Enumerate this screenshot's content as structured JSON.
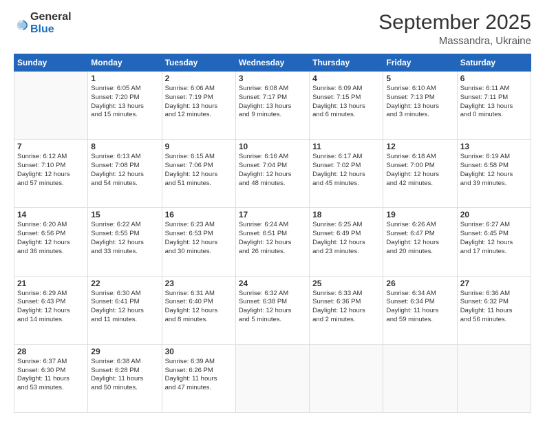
{
  "logo": {
    "part1": "General",
    "part2": "Blue"
  },
  "header": {
    "title": "September 2025",
    "subtitle": "Massandra, Ukraine"
  },
  "days_of_week": [
    "Sunday",
    "Monday",
    "Tuesday",
    "Wednesday",
    "Thursday",
    "Friday",
    "Saturday"
  ],
  "weeks": [
    [
      {
        "day": "",
        "info": ""
      },
      {
        "day": "1",
        "info": "Sunrise: 6:05 AM\nSunset: 7:20 PM\nDaylight: 13 hours\nand 15 minutes."
      },
      {
        "day": "2",
        "info": "Sunrise: 6:06 AM\nSunset: 7:19 PM\nDaylight: 13 hours\nand 12 minutes."
      },
      {
        "day": "3",
        "info": "Sunrise: 6:08 AM\nSunset: 7:17 PM\nDaylight: 13 hours\nand 9 minutes."
      },
      {
        "day": "4",
        "info": "Sunrise: 6:09 AM\nSunset: 7:15 PM\nDaylight: 13 hours\nand 6 minutes."
      },
      {
        "day": "5",
        "info": "Sunrise: 6:10 AM\nSunset: 7:13 PM\nDaylight: 13 hours\nand 3 minutes."
      },
      {
        "day": "6",
        "info": "Sunrise: 6:11 AM\nSunset: 7:11 PM\nDaylight: 13 hours\nand 0 minutes."
      }
    ],
    [
      {
        "day": "7",
        "info": "Sunrise: 6:12 AM\nSunset: 7:10 PM\nDaylight: 12 hours\nand 57 minutes."
      },
      {
        "day": "8",
        "info": "Sunrise: 6:13 AM\nSunset: 7:08 PM\nDaylight: 12 hours\nand 54 minutes."
      },
      {
        "day": "9",
        "info": "Sunrise: 6:15 AM\nSunset: 7:06 PM\nDaylight: 12 hours\nand 51 minutes."
      },
      {
        "day": "10",
        "info": "Sunrise: 6:16 AM\nSunset: 7:04 PM\nDaylight: 12 hours\nand 48 minutes."
      },
      {
        "day": "11",
        "info": "Sunrise: 6:17 AM\nSunset: 7:02 PM\nDaylight: 12 hours\nand 45 minutes."
      },
      {
        "day": "12",
        "info": "Sunrise: 6:18 AM\nSunset: 7:00 PM\nDaylight: 12 hours\nand 42 minutes."
      },
      {
        "day": "13",
        "info": "Sunrise: 6:19 AM\nSunset: 6:58 PM\nDaylight: 12 hours\nand 39 minutes."
      }
    ],
    [
      {
        "day": "14",
        "info": "Sunrise: 6:20 AM\nSunset: 6:56 PM\nDaylight: 12 hours\nand 36 minutes."
      },
      {
        "day": "15",
        "info": "Sunrise: 6:22 AM\nSunset: 6:55 PM\nDaylight: 12 hours\nand 33 minutes."
      },
      {
        "day": "16",
        "info": "Sunrise: 6:23 AM\nSunset: 6:53 PM\nDaylight: 12 hours\nand 30 minutes."
      },
      {
        "day": "17",
        "info": "Sunrise: 6:24 AM\nSunset: 6:51 PM\nDaylight: 12 hours\nand 26 minutes."
      },
      {
        "day": "18",
        "info": "Sunrise: 6:25 AM\nSunset: 6:49 PM\nDaylight: 12 hours\nand 23 minutes."
      },
      {
        "day": "19",
        "info": "Sunrise: 6:26 AM\nSunset: 6:47 PM\nDaylight: 12 hours\nand 20 minutes."
      },
      {
        "day": "20",
        "info": "Sunrise: 6:27 AM\nSunset: 6:45 PM\nDaylight: 12 hours\nand 17 minutes."
      }
    ],
    [
      {
        "day": "21",
        "info": "Sunrise: 6:29 AM\nSunset: 6:43 PM\nDaylight: 12 hours\nand 14 minutes."
      },
      {
        "day": "22",
        "info": "Sunrise: 6:30 AM\nSunset: 6:41 PM\nDaylight: 12 hours\nand 11 minutes."
      },
      {
        "day": "23",
        "info": "Sunrise: 6:31 AM\nSunset: 6:40 PM\nDaylight: 12 hours\nand 8 minutes."
      },
      {
        "day": "24",
        "info": "Sunrise: 6:32 AM\nSunset: 6:38 PM\nDaylight: 12 hours\nand 5 minutes."
      },
      {
        "day": "25",
        "info": "Sunrise: 6:33 AM\nSunset: 6:36 PM\nDaylight: 12 hours\nand 2 minutes."
      },
      {
        "day": "26",
        "info": "Sunrise: 6:34 AM\nSunset: 6:34 PM\nDaylight: 11 hours\nand 59 minutes."
      },
      {
        "day": "27",
        "info": "Sunrise: 6:36 AM\nSunset: 6:32 PM\nDaylight: 11 hours\nand 56 minutes."
      }
    ],
    [
      {
        "day": "28",
        "info": "Sunrise: 6:37 AM\nSunset: 6:30 PM\nDaylight: 11 hours\nand 53 minutes."
      },
      {
        "day": "29",
        "info": "Sunrise: 6:38 AM\nSunset: 6:28 PM\nDaylight: 11 hours\nand 50 minutes."
      },
      {
        "day": "30",
        "info": "Sunrise: 6:39 AM\nSunset: 6:26 PM\nDaylight: 11 hours\nand 47 minutes."
      },
      {
        "day": "",
        "info": ""
      },
      {
        "day": "",
        "info": ""
      },
      {
        "day": "",
        "info": ""
      },
      {
        "day": "",
        "info": ""
      }
    ]
  ]
}
